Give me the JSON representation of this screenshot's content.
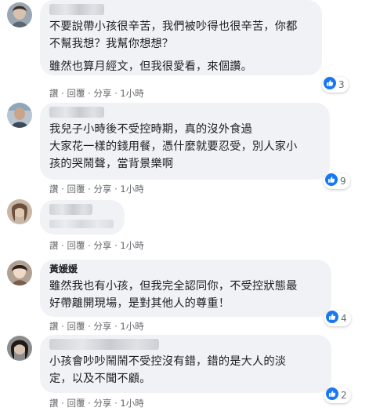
{
  "colors": {
    "bubble": "#f0f2f5",
    "text": "#1c1e21",
    "meta": "#65676b",
    "like_blue": "#1877f2"
  },
  "comments": [
    {
      "author": "",
      "lines": [
        "不要說帶小孩很辛苦，我們被吵得也很辛苦，你都",
        "不幫我想？我幫你想想？"
      ],
      "lines2": [
        "雖然也算月經文，但我很愛看，來個讚。"
      ],
      "actions": {
        "like": "讚",
        "reply": "回覆",
        "share": "分享",
        "time": "1小時"
      },
      "reactions": {
        "icon": "like-icon",
        "count": "3"
      }
    },
    {
      "author": "",
      "lines": [
        "我兒子小時後不受控時期，真的沒外食過",
        "大家花一樣的錢用餐，憑什麼就要忍受，別人家小",
        "孩的哭鬧聲，當背景樂啊"
      ],
      "actions": {
        "like": "讚",
        "reply": "回覆",
        "share": "分享",
        "time": "1小時"
      },
      "reactions": {
        "icon": "like-icon",
        "count": "9"
      }
    },
    {
      "author": "",
      "actions": {
        "like": "讚",
        "reply": "回覆",
        "share": "分享",
        "time": "1小時"
      }
    },
    {
      "author": "黃媛媛",
      "lines": [
        "雖然我也有小孩，但我完全認同你，不受控狀態最",
        "好帶離開現場，是對其他人的尊重！"
      ],
      "actions": {
        "like": "讚",
        "reply": "回覆",
        "share": "分享",
        "time": "1小時"
      },
      "reactions": {
        "icon": "like-icon",
        "count": "4"
      }
    },
    {
      "author": "",
      "lines": [
        "小孩會吵吵鬧鬧不受控沒有錯，錯的是大人的淡",
        "定，以及不聞不顧。"
      ],
      "actions": {
        "like": "讚",
        "reply": "回覆",
        "share": "分享",
        "time": "1小時"
      },
      "reactions": {
        "icon": "like-icon",
        "count": "2"
      }
    }
  ]
}
